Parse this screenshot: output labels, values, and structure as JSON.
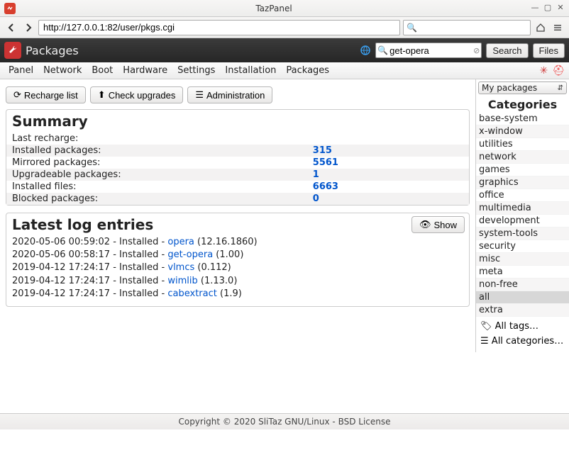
{
  "window": {
    "title": "TazPanel"
  },
  "nav": {
    "url": "http://127.0.0.1:82/user/pkgs.cgi"
  },
  "header": {
    "title": "Packages",
    "search_value": "get-opera",
    "search_btn": "Search",
    "files_btn": "Files"
  },
  "menu": {
    "items": [
      "Panel",
      "Network",
      "Boot",
      "Hardware",
      "Settings",
      "Installation",
      "Packages"
    ]
  },
  "actions": {
    "recharge": "Recharge list",
    "check": "Check upgrades",
    "admin": "Administration"
  },
  "summary": {
    "heading": "Summary",
    "rows": [
      {
        "label": "Last recharge:",
        "value": "",
        "link": false
      },
      {
        "label": "Installed packages:",
        "value": "315",
        "link": true
      },
      {
        "label": "Mirrored packages:",
        "value": "5561",
        "link": true
      },
      {
        "label": "Upgradeable packages:",
        "value": "1",
        "link": true
      },
      {
        "label": "Installed files:",
        "value": "6663",
        "link": false
      },
      {
        "label": "Blocked packages:",
        "value": "0",
        "link": true
      }
    ]
  },
  "loghead": {
    "heading": "Latest log entries",
    "show_btn": "Show"
  },
  "log": [
    {
      "ts": "2020-05-06 00:59:02",
      "action": "Installed",
      "pkg": "opera",
      "ver": "(12.16.1860)"
    },
    {
      "ts": "2020-05-06 00:58:17",
      "action": "Installed",
      "pkg": "get-opera",
      "ver": "(1.00)"
    },
    {
      "ts": "2019-04-12 17:24:17",
      "action": "Installed",
      "pkg": "vlmcs",
      "ver": "(0.112)"
    },
    {
      "ts": "2019-04-12 17:24:17",
      "action": "Installed",
      "pkg": "wimlib",
      "ver": "(1.13.0)"
    },
    {
      "ts": "2019-04-12 17:24:17",
      "action": "Installed",
      "pkg": "cabextract",
      "ver": "(1.9)"
    }
  ],
  "sidebar": {
    "mypkg": "My packages",
    "cat_heading": "Categories",
    "categories": [
      "base-system",
      "x-window",
      "utilities",
      "network",
      "games",
      "graphics",
      "office",
      "multimedia",
      "development",
      "system-tools",
      "security",
      "misc",
      "meta",
      "non-free",
      "all",
      "extra"
    ],
    "selected": "all",
    "all_tags": "All tags…",
    "all_cats": "All categories…"
  },
  "footer": {
    "text": "Copyright © 2020 SliTaz GNU/Linux - BSD License"
  }
}
